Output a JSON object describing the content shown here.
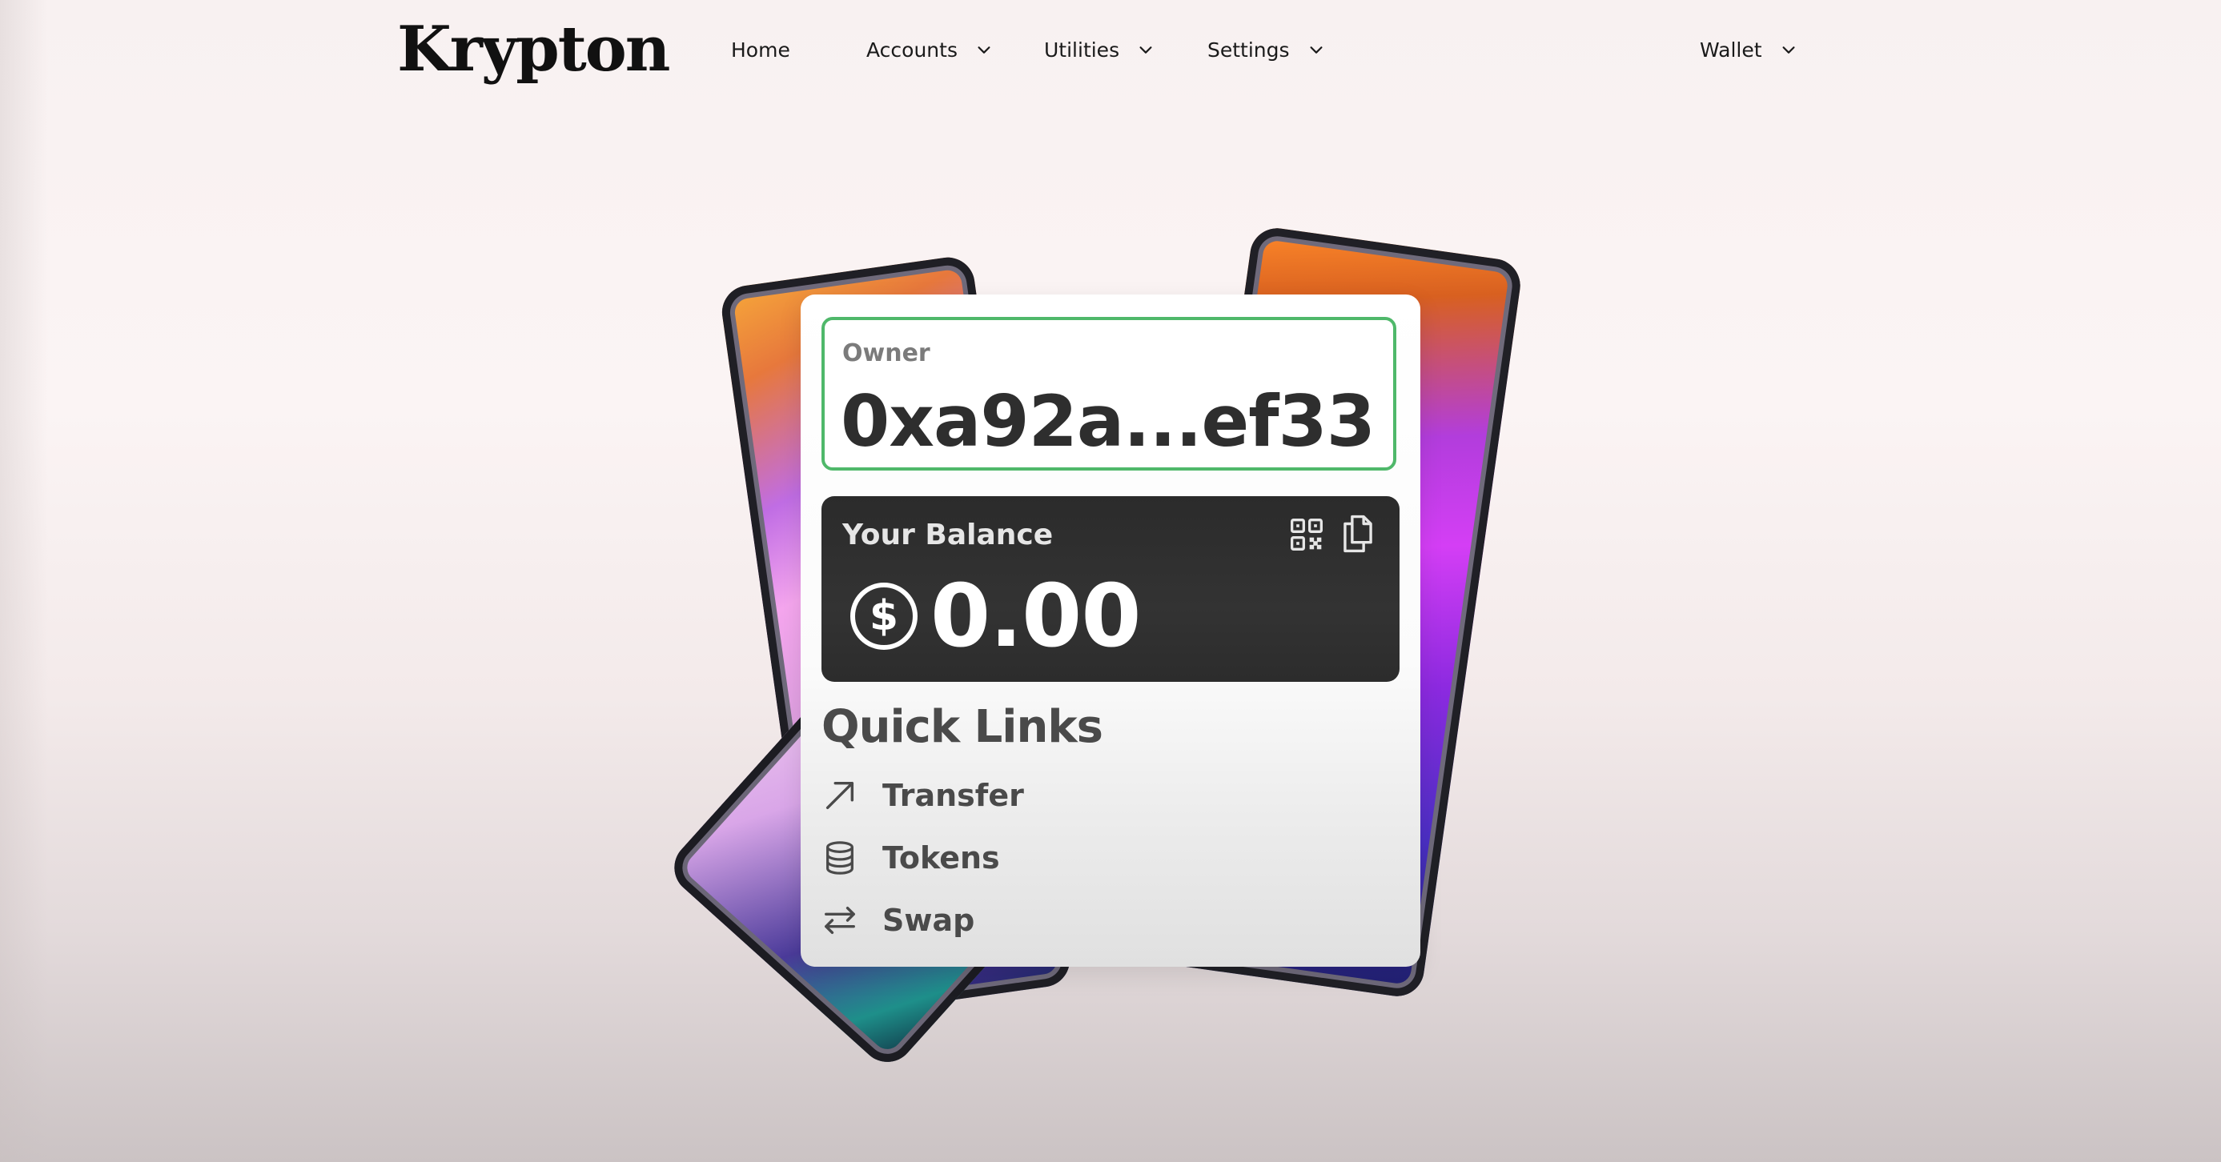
{
  "brand": {
    "name": "Krypton"
  },
  "nav": {
    "home": "Home",
    "accounts": "Accounts",
    "utilities": "Utilities",
    "settings": "Settings",
    "wallet": "Wallet"
  },
  "card": {
    "owner_label": "Owner",
    "owner_address": "0xa92a...ef33",
    "balance_label": "Your Balance",
    "balance_amount": "0.00",
    "quick_links_title": "Quick Links",
    "quick_links": [
      {
        "label": "Transfer",
        "icon": "arrow-up-right-icon"
      },
      {
        "label": "Tokens",
        "icon": "coin-stack-icon"
      },
      {
        "label": "Swap",
        "icon": "swap-arrows-icon"
      }
    ]
  },
  "colors": {
    "accent_border": "#4fb86a",
    "balance_bg": "#2b2b2b"
  }
}
